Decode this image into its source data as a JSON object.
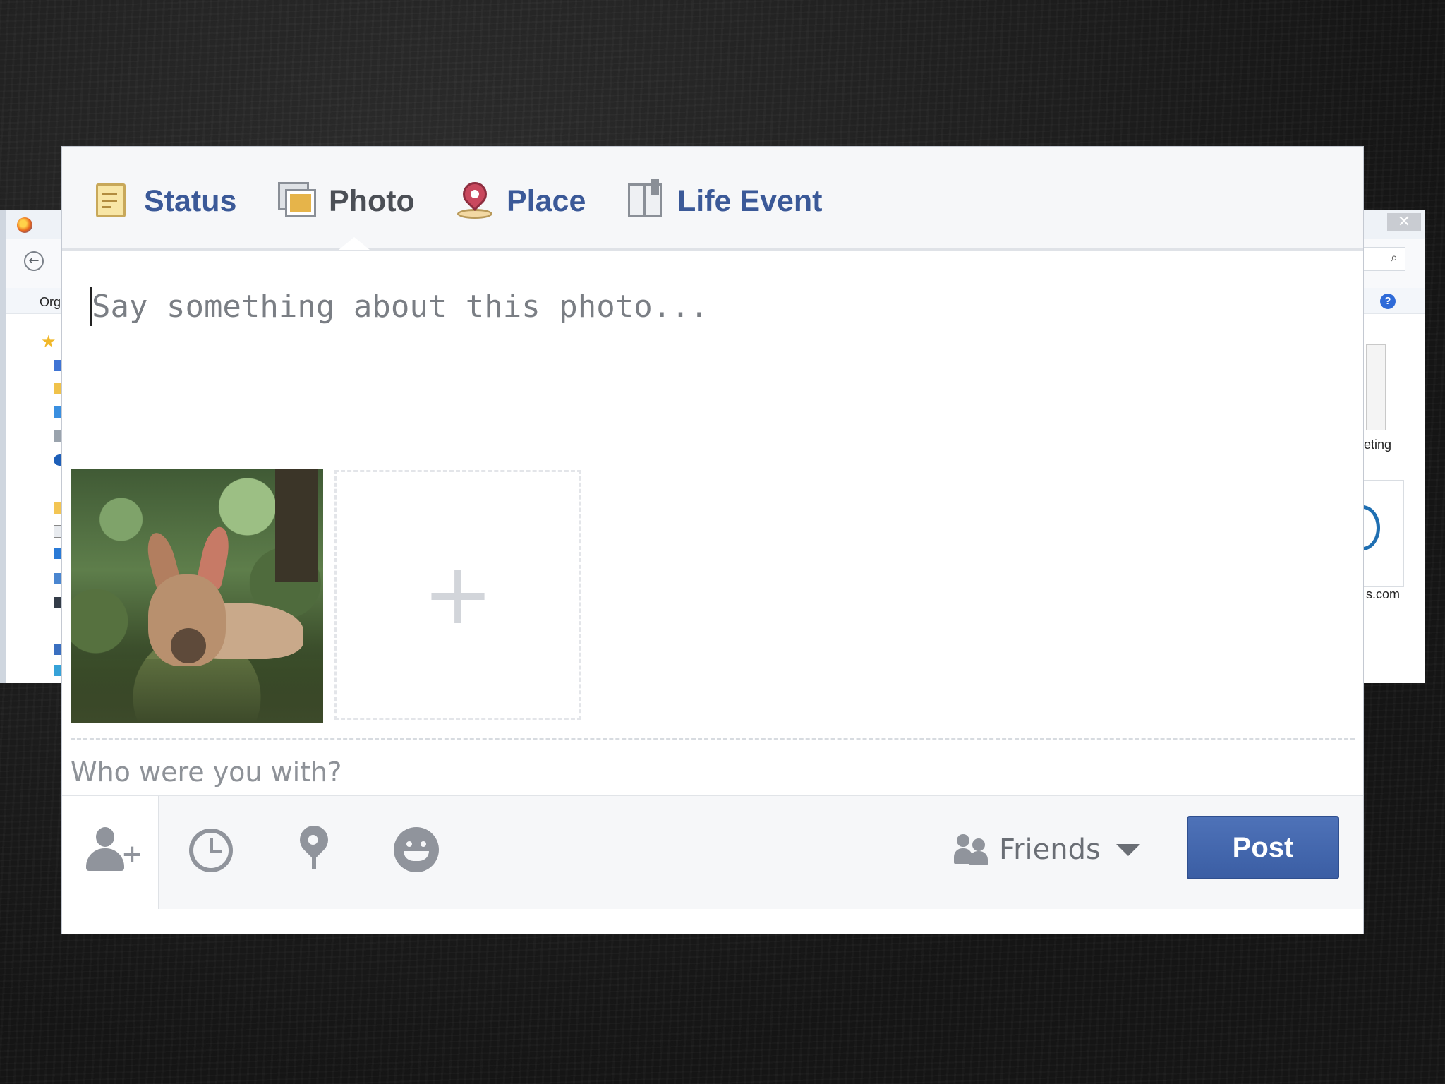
{
  "background_window": {
    "toolbar_label": "Orga",
    "close_glyph": "✕",
    "back_glyph": "←",
    "search_glyph": "⌕",
    "help_glyph": "?",
    "file_label_1": "eting",
    "file_label_2": "s.com"
  },
  "dialog": {
    "tabs": [
      {
        "label": "Status",
        "icon": "status-icon"
      },
      {
        "label": "Photo",
        "icon": "photo-icon",
        "active": true
      },
      {
        "label": "Place",
        "icon": "place-icon"
      },
      {
        "label": "Life Event",
        "icon": "life-event-icon"
      }
    ],
    "composer": {
      "placeholder": "Say something about this photo...",
      "value": ""
    },
    "attachments": {
      "add_more_glyph": "+"
    },
    "with_field": {
      "placeholder": "Who were you with?",
      "value": ""
    },
    "actions": {
      "icons": [
        "tag-people-icon",
        "clock-icon",
        "location-pin-icon",
        "feeling-smile-icon"
      ],
      "audience_label": "Friends",
      "post_label": "Post"
    }
  },
  "colors": {
    "fb_blue": "#3b5998",
    "post_button": "#4267b2",
    "muted_icon": "#90949c"
  }
}
